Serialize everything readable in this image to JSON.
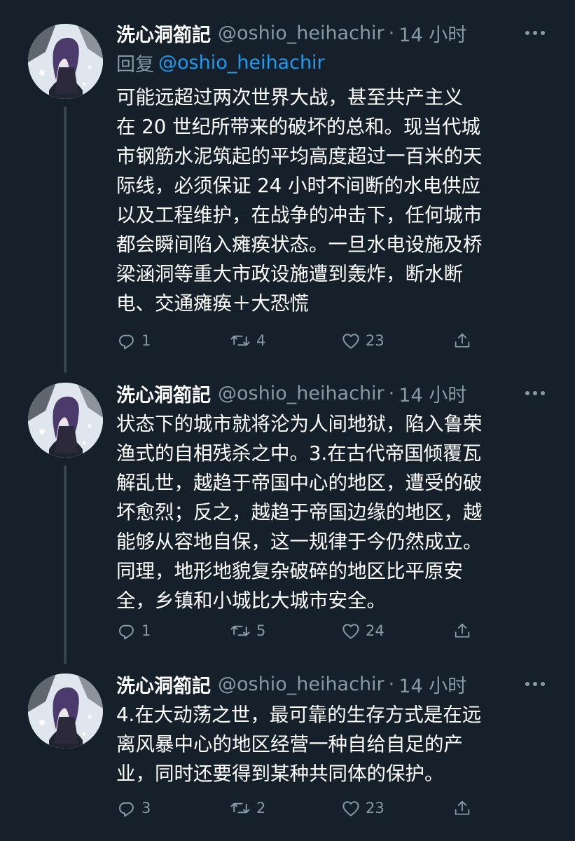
{
  "tweets": [
    {
      "display_name": "洗心洞箚記",
      "handle": "@oshio_heihachir",
      "dot": "·",
      "time": "14 小时",
      "reply_label": "回复",
      "reply_mention": "@oshio_heihachir",
      "text": "可能远超过两次世界大战，甚至共产主义\n在 20 世纪所带来的破坏的总和。现当代城\n市钢筋水泥筑起的平均高度超过一百米的天\n际线，必须保证 24 小时不间断的水电供应\n以及工程维护，在战争的冲击下，任何城市\n都会瞬间陷入瘫痪状态。一旦水电设施及桥\n梁涵洞等重大市政设施遭到轰炸，断水断\n电、交通瘫痪＋大恐慌",
      "replies": "1",
      "retweets": "4",
      "likes": "23"
    },
    {
      "display_name": "洗心洞箚記",
      "handle": "@oshio_heihachir",
      "dot": "·",
      "time": "14 小时",
      "text": "状态下的城市就将沦为人间地狱，陷入鲁荣\n渔式的自相残杀之中。3.在古代帝国倾覆瓦\n解乱世，越趋于帝国中心的地区，遭受的破\n坏愈烈；反之，越趋于帝国边缘的地区，越\n能够从容地自保，这一规律于今仍然成立。\n同理，地形地貌复杂破碎的地区比平原安\n全，乡镇和小城比大城市安全。",
      "replies": "1",
      "retweets": "5",
      "likes": "24"
    },
    {
      "display_name": "洗心洞箚記",
      "handle": "@oshio_heihachir",
      "dot": "·",
      "time": "14 小时",
      "text": "4.在大动荡之世，最可靠的生存方式是在远\n离风暴中心的地区经营一种自给自足的产\n业，同时还要得到某种共同体的保护。",
      "replies": "3",
      "retweets": "2",
      "likes": "23"
    }
  ],
  "icons": {
    "more": "more-horizontal-icon",
    "reply": "reply-bubble-icon",
    "retweet": "retweet-arrows-icon",
    "like": "heart-icon",
    "share": "share-upload-icon"
  },
  "colors": {
    "background": "#15202b",
    "text": "#ffffff",
    "secondary": "#8899a6",
    "link": "#1d9bf0",
    "thread_line": "#38444d"
  }
}
